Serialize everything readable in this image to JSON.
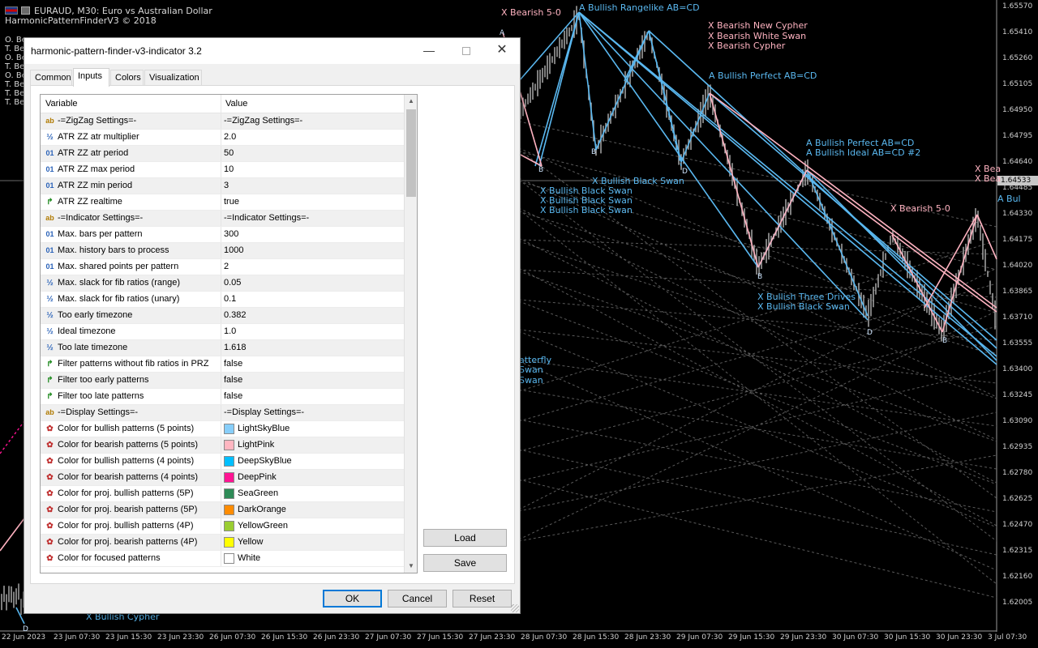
{
  "chart": {
    "symbol_line": "EURAUD, M30:  Euro vs Australian Dollar",
    "indicator_line": "HarmonicPatternFinderV3 © 2018",
    "left_list": [
      "O. Be",
      "T. Be",
      "O. Be",
      "T. Be",
      "O. Be",
      "T. Be",
      "T. Be",
      "T. Be"
    ],
    "price_labels": [
      "1.65570",
      "1.65410",
      "1.65260",
      "1.65105",
      "1.64950",
      "1.64795",
      "1.64640",
      "1.64485",
      "1.64330",
      "1.64175",
      "1.64020",
      "1.63865",
      "1.63710",
      "1.63555",
      "1.63400",
      "1.63245",
      "1.63090",
      "1.62935",
      "1.62780",
      "1.62625",
      "1.62470",
      "1.62315",
      "1.62160",
      "1.62005"
    ],
    "current_price": "1.64533",
    "time_labels": [
      "22 Jun 2023",
      "23 Jun 07:30",
      "23 Jun 15:30",
      "23 Jun 23:30",
      "26 Jun 07:30",
      "26 Jun 15:30",
      "26 Jun 23:30",
      "27 Jun 07:30",
      "27 Jun 15:30",
      "27 Jun 23:30",
      "28 Jun 07:30",
      "28 Jun 15:30",
      "28 Jun 23:30",
      "29 Jun 07:30",
      "29 Jun 15:30",
      "29 Jun 23:30",
      "30 Jun 07:30",
      "30 Jun 15:30",
      "30 Jun 23:30",
      "3 Jul 07:30"
    ],
    "pattern_labels": [
      {
        "text": "X Bearish 5-0",
        "color": "pink"
      },
      {
        "text": "A Bullish Rangelike AB=CD",
        "color": "blue"
      },
      {
        "text": "X Bearish New Cypher",
        "color": "pink"
      },
      {
        "text": "X Bearish White Swan",
        "color": "pink"
      },
      {
        "text": "X Bearish Cypher",
        "color": "pink"
      },
      {
        "text": "A Bullish Perfect AB=CD",
        "color": "blue"
      },
      {
        "text": "A Bullish Perfect AB=CD",
        "color": "blue"
      },
      {
        "text": "A Bullish Ideal AB=CD #2",
        "color": "blue"
      },
      {
        "text": "X Bullish Black Swan",
        "color": "blue"
      },
      {
        "text": "X Bullish Black Swan",
        "color": "blue"
      },
      {
        "text": "X Bullish Black Swan",
        "color": "blue"
      },
      {
        "text": "X Bullish Black Swan",
        "color": "blue"
      },
      {
        "text": "X Bearish 5-0",
        "color": "pink"
      },
      {
        "text": "X Bea",
        "color": "pink"
      },
      {
        "text": "X Bea",
        "color": "pink"
      },
      {
        "text": "A Bul",
        "color": "blue"
      },
      {
        "text": "X Bullish Three Drives",
        "color": "blue"
      },
      {
        "text": "X Bullish Black Swan",
        "color": "blue"
      },
      {
        "text": "atterfly",
        "color": "blue"
      },
      {
        "text": "Swan",
        "color": "blue"
      },
      {
        "text": "Swan",
        "color": "blue"
      },
      {
        "text": "X Bullish Cypher",
        "color": "blue"
      }
    ],
    "point_letters": [
      "A",
      "B",
      "B",
      "D",
      "B",
      "D",
      "B",
      "D"
    ]
  },
  "dialog": {
    "title": "harmonic-pattern-finder-v3-indicator 3.2",
    "tabs": [
      "Common",
      "Inputs",
      "Colors",
      "Visualization"
    ],
    "active_tab": "Inputs",
    "columns": [
      "Variable",
      "Value"
    ],
    "rows": [
      {
        "icon": "ab",
        "name": "-=ZigZag Settings=-",
        "value": "-=ZigZag Settings=-"
      },
      {
        "icon": "half",
        "name": "ATR ZZ atr multiplier",
        "value": "2.0"
      },
      {
        "icon": "num",
        "name": "ATR ZZ atr period",
        "value": "50"
      },
      {
        "icon": "num",
        "name": "ATR ZZ max period",
        "value": "10"
      },
      {
        "icon": "num",
        "name": "ATR ZZ min period",
        "value": "3"
      },
      {
        "icon": "flag",
        "name": "ATR ZZ realtime",
        "value": "true"
      },
      {
        "icon": "ab",
        "name": "-=Indicator Settings=-",
        "value": "-=Indicator Settings=-"
      },
      {
        "icon": "num",
        "name": "Max. bars per pattern",
        "value": "300"
      },
      {
        "icon": "num",
        "name": "Max. history bars to process",
        "value": "1000"
      },
      {
        "icon": "num",
        "name": "Max. shared points per pattern",
        "value": "2"
      },
      {
        "icon": "half",
        "name": "Max. slack for fib ratios (range)",
        "value": "0.05"
      },
      {
        "icon": "half",
        "name": "Max. slack for fib ratios (unary)",
        "value": "0.1"
      },
      {
        "icon": "half",
        "name": "Too early timezone",
        "value": "0.382"
      },
      {
        "icon": "half",
        "name": "Ideal timezone",
        "value": "1.0"
      },
      {
        "icon": "half",
        "name": "Too late timezone",
        "value": "1.618"
      },
      {
        "icon": "flag",
        "name": "Filter patterns without fib ratios in PRZ",
        "value": "false"
      },
      {
        "icon": "flag",
        "name": "Filter too early patterns",
        "value": "false"
      },
      {
        "icon": "flag",
        "name": "Filter too late patterns",
        "value": "false"
      },
      {
        "icon": "ab",
        "name": "-=Display Settings=-",
        "value": "-=Display Settings=-"
      },
      {
        "icon": "color",
        "name": "Color for bullish patterns (5 points)",
        "value": "LightSkyBlue",
        "swatch": "#87cefa"
      },
      {
        "icon": "color",
        "name": "Color for bearish patterns (5 points)",
        "value": "LightPink",
        "swatch": "#ffb6c1"
      },
      {
        "icon": "color",
        "name": "Color for bullish patterns (4 points)",
        "value": "DeepSkyBlue",
        "swatch": "#00bfff"
      },
      {
        "icon": "color",
        "name": "Color for bearish patterns (4 points)",
        "value": "DeepPink",
        "swatch": "#ff1493"
      },
      {
        "icon": "color",
        "name": "Color for proj. bullish patterns (5P)",
        "value": "SeaGreen",
        "swatch": "#2e8b57"
      },
      {
        "icon": "color",
        "name": "Color for proj. bearish patterns (5P)",
        "value": "DarkOrange",
        "swatch": "#ff8c00"
      },
      {
        "icon": "color",
        "name": "Color for proj. bullish patterns (4P)",
        "value": "YellowGreen",
        "swatch": "#9acd32"
      },
      {
        "icon": "color",
        "name": "Color for proj. bearish patterns (4P)",
        "value": "Yellow",
        "swatch": "#ffff00"
      },
      {
        "icon": "color",
        "name": "Color for focused patterns",
        "value": "White",
        "swatch": "#ffffff"
      }
    ],
    "buttons": {
      "load": "Load",
      "save": "Save",
      "ok": "OK",
      "cancel": "Cancel",
      "reset": "Reset"
    },
    "window": {
      "minimize": "—",
      "close": "✕"
    }
  },
  "colors": {
    "bullish": "#5ab8f0",
    "bearish": "#ffb3c1",
    "chart_bg": "#000000"
  }
}
